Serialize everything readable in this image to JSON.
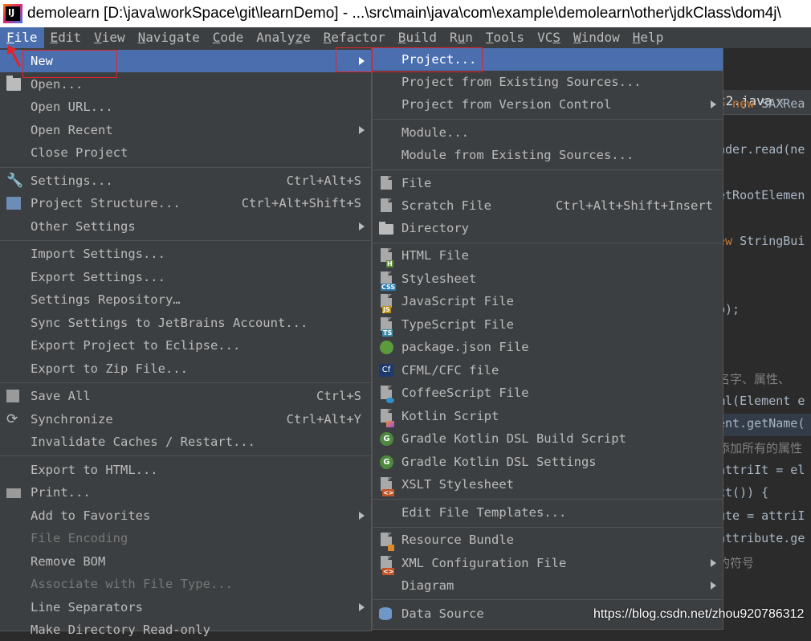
{
  "window": {
    "title": "demolearn [D:\\java\\workSpace\\git\\learnDemo] - ...\\src\\main\\java\\com\\example\\demolearn\\other\\jdkClass\\dom4j\\"
  },
  "menubar": {
    "items": [
      {
        "pre": "",
        "mn": "F",
        "post": "ile"
      },
      {
        "pre": "",
        "mn": "E",
        "post": "dit"
      },
      {
        "pre": "",
        "mn": "V",
        "post": "iew"
      },
      {
        "pre": "",
        "mn": "N",
        "post": "avigate"
      },
      {
        "pre": "",
        "mn": "C",
        "post": "ode"
      },
      {
        "pre": "Analy",
        "mn": "z",
        "post": "e"
      },
      {
        "pre": "",
        "mn": "R",
        "post": "efactor"
      },
      {
        "pre": "",
        "mn": "B",
        "post": "uild"
      },
      {
        "pre": "R",
        "mn": "u",
        "post": "n"
      },
      {
        "pre": "",
        "mn": "T",
        "post": "ools"
      },
      {
        "pre": "VC",
        "mn": "S",
        "post": ""
      },
      {
        "pre": "",
        "mn": "W",
        "post": "indow"
      },
      {
        "pre": "",
        "mn": "H",
        "post": "elp"
      }
    ]
  },
  "editor": {
    "tab_label": "t2.java",
    "tab_close": "✕",
    "lines": [
      {
        "kw": "= new ",
        "txt": "SAXRea"
      },
      {
        "kw": "",
        "txt": "ader.read(ne"
      },
      {
        "kw": "",
        "txt": "etRootElemen"
      },
      {
        "kw": "ew ",
        "txt": "StringBui"
      },
      {
        "kw": "",
        "txt": "b);"
      },
      {
        "kw": "",
        "txt": "名字、属性、"
      },
      {
        "kw": "",
        "txt": "ml(Element e"
      },
      {
        "kw": "",
        "txt": "ent.getName("
      },
      {
        "kw": "",
        "txt": "添加所有的属性"
      },
      {
        "kw": "",
        "txt": "attriIt = el"
      },
      {
        "kw": "",
        "txt": "xt()) {"
      },
      {
        "kw": "",
        "txt": "ute = attriI"
      },
      {
        "kw": "",
        "txt": "attribute.ge"
      },
      {
        "kw": "",
        "txt": "的符号"
      }
    ]
  },
  "file_menu": {
    "new": "New",
    "open": "Open...",
    "open_url": "Open URL...",
    "open_recent": "Open Recent",
    "close_project": "Close Project",
    "settings": "Settings...",
    "settings_sc": "Ctrl+Alt+S",
    "project_structure": "Project Structure...",
    "project_structure_sc": "Ctrl+Alt+Shift+S",
    "other_settings": "Other Settings",
    "import_settings": "Import Settings...",
    "export_settings": "Export Settings...",
    "settings_repository": "Settings Repository…",
    "sync_settings": "Sync Settings to JetBrains Account...",
    "export_eclipse": "Export Project to Eclipse...",
    "export_zip": "Export to Zip File...",
    "save_all": "Save All",
    "save_all_sc": "Ctrl+S",
    "synchronize": "Synchronize",
    "synchronize_sc": "Ctrl+Alt+Y",
    "invalidate": "Invalidate Caches / Restart...",
    "export_html": "Export to HTML...",
    "print": "Print...",
    "add_favorites": "Add to Favorites",
    "file_encoding": "File Encoding",
    "remove_bom": "Remove BOM",
    "associate": "Associate with File Type...",
    "line_separators": "Line Separators",
    "make_readonly": "Make Directory Read-only"
  },
  "new_menu": {
    "project": "Project...",
    "project_existing": "Project from Existing Sources...",
    "project_vcs": "Project from Version Control",
    "module": "Module...",
    "module_existing": "Module from Existing Sources...",
    "file": "File",
    "scratch_file": "Scratch File",
    "scratch_file_sc": "Ctrl+Alt+Shift+Insert",
    "directory": "Directory",
    "html_file": "HTML File",
    "stylesheet": "Stylesheet",
    "javascript_file": "JavaScript File",
    "typescript_file": "TypeScript File",
    "package_json": "package.json File",
    "cfml_file": "CFML/CFC file",
    "coffeescript_file": "CoffeeScript File",
    "kotlin_script": "Kotlin Script",
    "gradle_kotlin_build": "Gradle Kotlin DSL Build Script",
    "gradle_kotlin_settings": "Gradle Kotlin DSL Settings",
    "xslt_stylesheet": "XSLT Stylesheet",
    "edit_templates": "Edit File Templates...",
    "resource_bundle": "Resource Bundle",
    "xml_config": "XML Configuration File",
    "diagram": "Diagram",
    "data_source": "Data Source"
  },
  "icon_badges": {
    "html": "H",
    "css": "CSS",
    "js": "JS",
    "ts": "TS",
    "cfml": "Cf",
    "gradle": "G",
    "xslt": "<>",
    "xml": "<>"
  },
  "colors": {
    "menu_bg": "#3c3f41",
    "highlight": "#4b6eaf",
    "annotation_red": "#e0242a"
  },
  "watermark": "https://blog.csdn.net/zhou920786312"
}
